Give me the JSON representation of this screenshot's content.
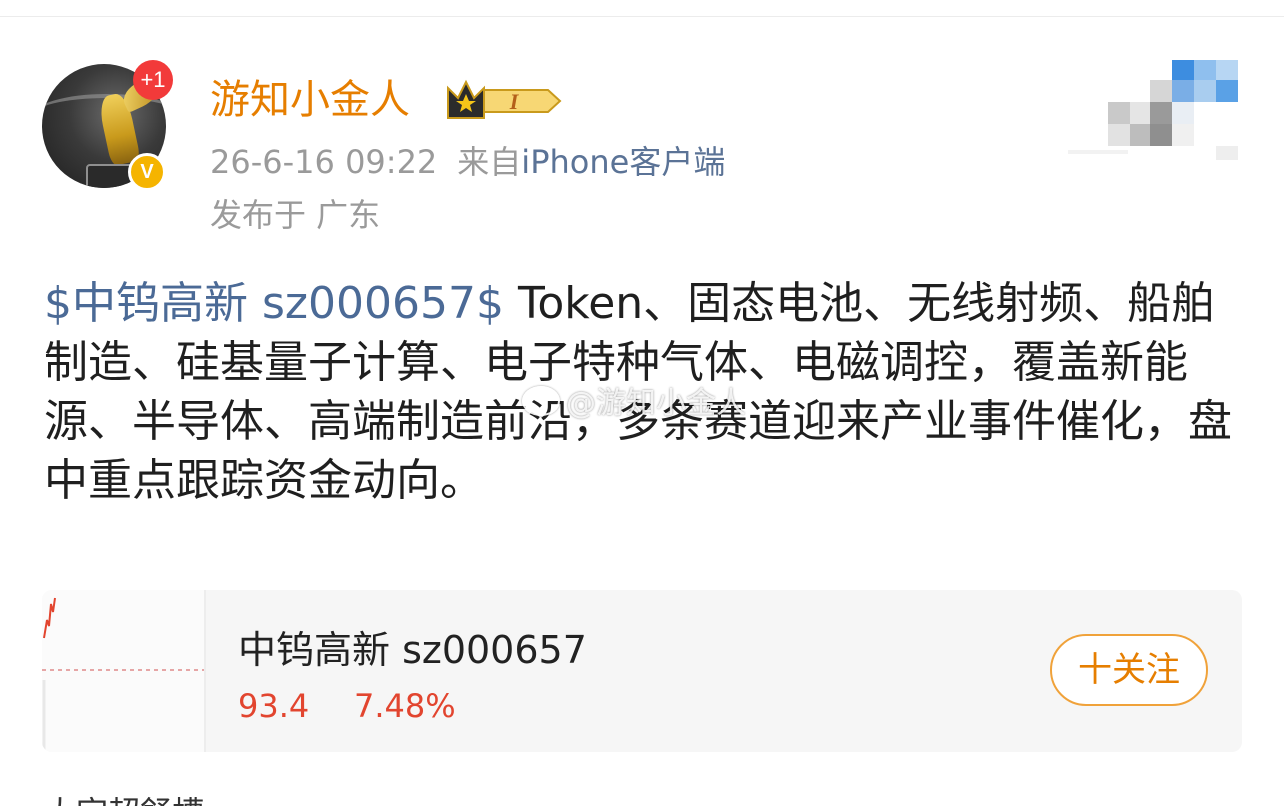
{
  "user": {
    "name": "游知小金人",
    "notification_count": "+1",
    "verified_mark": "V",
    "member_level": "I",
    "avatar_icon": "avatar-statue-icon"
  },
  "meta": {
    "time": "26-6-16 09:22",
    "source_prefix": "来自",
    "source_client": "iPhone客户端",
    "location": "发布于 广东"
  },
  "post": {
    "stock_tag": "$中钨高新 sz000657$",
    "body": " Token、固态电池、无线射频、船舶制造、硅基量子计算、电子特种气体、电磁调控，覆盖新能源、半导体、高端制造前沿，多条赛道迎来产业事件催化，盘中重点跟踪资金动向。"
  },
  "watermark": {
    "text": "@游知小金人"
  },
  "stock_card": {
    "name": "中钨高新 sz000657",
    "price": "93.4",
    "change": "7.48%",
    "follow_label": "十关注"
  },
  "next_section": {
    "label": "大宗超舒槽"
  },
  "colors": {
    "username": "#e67e00",
    "link": "#4b6a96",
    "price_up": "#e2452f",
    "follow_border": "#f0a23a",
    "badge_red": "#f23a3a",
    "verify_gold": "#f5b400"
  }
}
